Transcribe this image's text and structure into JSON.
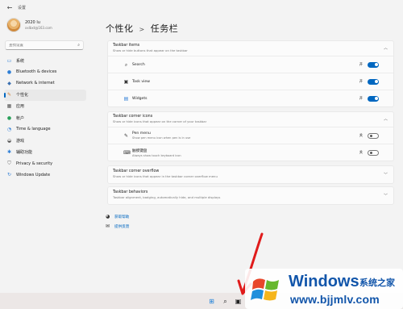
{
  "window": {
    "title": "设置",
    "back_icon": "arrow-left-icon"
  },
  "user": {
    "name": "2020 lu",
    "email": "xxlbxt@163.com"
  },
  "search": {
    "placeholder": "查找设置"
  },
  "sidebar": {
    "items": [
      {
        "label": "系统",
        "icon": "monitor-icon",
        "color": "#2f7fd6"
      },
      {
        "label": "Bluetooth & devices",
        "icon": "bluetooth-icon",
        "color": "#2f7fd6"
      },
      {
        "label": "Network & internet",
        "icon": "wifi-icon",
        "color": "#3a6fb0"
      },
      {
        "label": "个性化",
        "icon": "brush-icon",
        "color": "#d07c2f",
        "active": true
      },
      {
        "label": "应用",
        "icon": "apps-icon",
        "color": "#555555"
      },
      {
        "label": "帐户",
        "icon": "person-icon",
        "color": "#2aa05a"
      },
      {
        "label": "Time & language",
        "icon": "globe-clock-icon",
        "color": "#2f7fd6"
      },
      {
        "label": "游戏",
        "icon": "gamepad-icon",
        "color": "#555555"
      },
      {
        "label": "辅助功能",
        "icon": "accessibility-icon",
        "color": "#2f7fd6"
      },
      {
        "label": "Privacy & security",
        "icon": "shield-icon",
        "color": "#666666"
      },
      {
        "label": "Windows Update",
        "icon": "update-icon",
        "color": "#2f7fd6"
      }
    ]
  },
  "breadcrumb": {
    "parent": "个性化",
    "separator": ">",
    "current": "任务栏"
  },
  "taskbar_items": {
    "title": "Taskbar items",
    "subtitle": "Show or hide buttons that appear on the taskbar",
    "rows": [
      {
        "label": "Search",
        "icon": "search-icon",
        "state_label": "开",
        "on": true
      },
      {
        "label": "Task view",
        "icon": "task-view-icon",
        "state_label": "开",
        "on": true
      },
      {
        "label": "Widgets",
        "icon": "widgets-icon",
        "state_label": "开",
        "on": true
      }
    ]
  },
  "corner_icons": {
    "title": "Taskbar corner icons",
    "subtitle": "Show or hide icons that appear on the corner of your taskbar",
    "rows": [
      {
        "label": "Pen menu",
        "sub": "Show pen menu icon when pen is in use",
        "icon": "pen-icon",
        "state_label": "关",
        "on": false
      },
      {
        "label": "触摸键盘",
        "sub": "Always show touch keyboard icon",
        "icon": "keyboard-icon",
        "state_label": "关",
        "on": false
      }
    ]
  },
  "corner_overflow": {
    "title": "Taskbar corner overflow",
    "subtitle": "Show or hide icons that appear in the taskbar corner overflow menu"
  },
  "behaviors": {
    "title": "Taskbar behaviors",
    "subtitle": "Taskbar alignment, badging, automatically hide, and multiple displays"
  },
  "help": {
    "get_help": "获取帮助",
    "feedback": "提供反馈"
  },
  "watermark": {
    "brand": "Windows",
    "cn": "系统之家",
    "url": "www.bjjmlv.com"
  },
  "accent_color": "#0067c0"
}
